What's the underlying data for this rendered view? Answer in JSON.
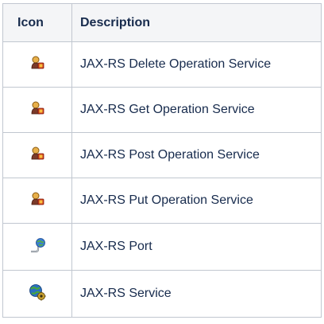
{
  "table": {
    "headers": {
      "icon": "Icon",
      "description": "Description"
    },
    "rows": [
      {
        "icon": "operation-service-icon",
        "description": "JAX-RS Delete Operation Service"
      },
      {
        "icon": "operation-service-icon",
        "description": "JAX-RS Get Operation Service"
      },
      {
        "icon": "operation-service-icon",
        "description": "JAX-RS Post Operation Service"
      },
      {
        "icon": "operation-service-icon",
        "description": "JAX-RS Put Operation Service"
      },
      {
        "icon": "port-icon",
        "description": "JAX-RS Port"
      },
      {
        "icon": "service-icon",
        "description": "JAX-RS Service"
      }
    ]
  },
  "colors": {
    "border": "#c1c7d0",
    "header_bg": "#f4f5f7",
    "text": "#172b4d"
  }
}
